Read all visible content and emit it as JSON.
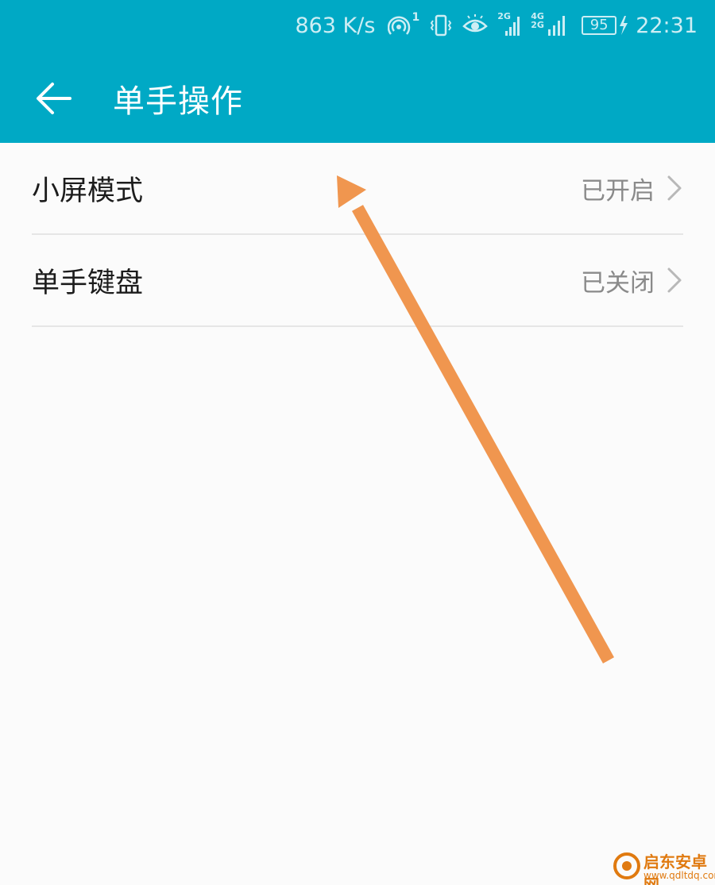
{
  "status_bar": {
    "net_speed": "863 K/s",
    "hotspot_count": "1",
    "sim1_label": "2G",
    "sim2_label_top": "4G",
    "sim2_label_bottom": "2G",
    "battery_level": "95",
    "time": "22:31"
  },
  "header": {
    "title": "单手操作",
    "back_icon": "arrow-left-icon",
    "background_color": "#00a9c5"
  },
  "settings": [
    {
      "label": "小屏模式",
      "value": "已开启"
    },
    {
      "label": "单手键盘",
      "value": "已关闭"
    }
  ],
  "annotation": {
    "arrow_color": "#f0964f"
  },
  "watermark": {
    "name": "启东安卓网",
    "url": "www.qdltdq.com",
    "color": "#e07a10"
  }
}
